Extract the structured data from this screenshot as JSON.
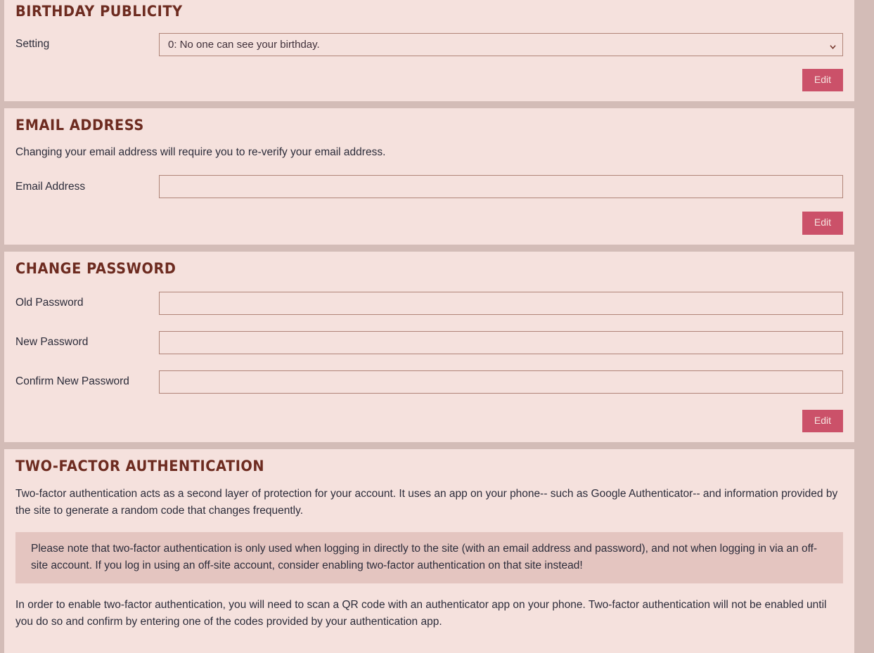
{
  "sections": [
    {
      "id": "birthday-publicity",
      "title": "BIRTHDAY PUBLICITY",
      "setting_label": "Setting",
      "setting_value": "0: No one can see your birthday.",
      "edit_label": "Edit"
    },
    {
      "id": "email-address",
      "title": "EMAIL ADDRESS",
      "description": "Changing your email address will require you to re-verify your email address.",
      "email_label": "Email Address",
      "email_value": "",
      "edit_label": "Edit"
    },
    {
      "id": "change-password",
      "title": "CHANGE PASSWORD",
      "old_password_label": "Old Password",
      "old_password_value": "",
      "new_password_label": "New Password",
      "new_password_value": "",
      "confirm_password_label": "Confirm New Password",
      "confirm_password_value": "",
      "edit_label": "Edit"
    },
    {
      "id": "two-factor-authentication",
      "title": "TWO-FACTOR AUTHENTICATION",
      "intro": "Two-factor authentication acts as a second layer of protection for your account. It uses an app on your phone-- such as Google Authenticator-- and information provided by the site to generate a random code that changes frequently.",
      "note": "Please note that two-factor authentication is only used when logging in directly to the site (with an email address and password), and not when logging in via an off-site account. If you log in using an off-site account, consider enabling two-factor authentication on that site instead!",
      "outro": "In order to enable two-factor authentication, you will need to scan a QR code with an authenticator app on your phone. Two-factor authentication will not be enabled until you do so and confirm by entering one of the codes provided by your authentication app."
    }
  ],
  "colors": {
    "page_background": "#d3bcb7",
    "panel_background": "#f5e1dd",
    "heading": "#6d2b20",
    "body_text": "#2c2c3a",
    "field_border": "#b08478",
    "button_background": "#cb5169",
    "button_text": "#f6e2df",
    "alert_background": "#e4c5c0"
  }
}
